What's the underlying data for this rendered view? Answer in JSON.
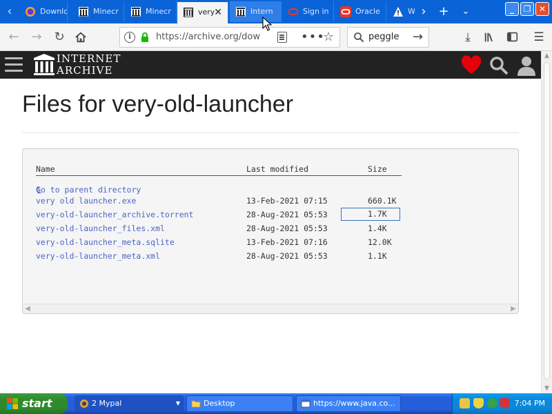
{
  "browser": {
    "tabs": [
      {
        "label": "Downlo",
        "icon": "firefox-icon"
      },
      {
        "label": "Minecr",
        "icon": "archive-icon"
      },
      {
        "label": "Minecr",
        "icon": "archive-icon"
      },
      {
        "label": "very",
        "icon": "archive-icon",
        "active": true
      },
      {
        "label": "Intern",
        "icon": "archive-icon"
      },
      {
        "label": "Sign in",
        "icon": "oracle-icon"
      },
      {
        "label": "Oracle",
        "icon": "oracle-icon"
      },
      {
        "label": "W",
        "icon": "warning-icon"
      }
    ],
    "address": "https://archive.org/dow",
    "search_value": "peggle"
  },
  "site": {
    "name_line1": "INTERNET",
    "name_line2": "ARCHIVE"
  },
  "page": {
    "title": "Files for very-old-launcher",
    "columns": {
      "name": "Name",
      "modified": "Last modified",
      "size": "Size"
    },
    "parent_link": "Go to parent directory",
    "files": [
      {
        "name": "very old launcher.exe",
        "modified": "13-Feb-2021 07:15",
        "size": "660.1K"
      },
      {
        "name": "very-old-launcher_archive.torrent",
        "modified": "28-Aug-2021 05:53",
        "size": "1.7K"
      },
      {
        "name": "very-old-launcher_files.xml",
        "modified": "28-Aug-2021 05:53",
        "size": "1.4K"
      },
      {
        "name": "very-old-launcher_meta.sqlite",
        "modified": "13-Feb-2021 07:16",
        "size": "12.0K"
      },
      {
        "name": "very-old-launcher_meta.xml",
        "modified": "28-Aug-2021 05:53",
        "size": "1.1K"
      }
    ]
  },
  "taskbar": {
    "start_label": "start",
    "items": [
      {
        "label": "2 Mypal"
      },
      {
        "label": "Desktop"
      },
      {
        "label": "https://www.java.co..."
      }
    ],
    "clock": "7:04 PM"
  },
  "colors": {
    "tabbar": "#0a64d8",
    "header": "#222222",
    "link": "#4b64c8",
    "heart": "#e8000a",
    "taskbar": "#245edb",
    "start": "#2f8a2f"
  }
}
